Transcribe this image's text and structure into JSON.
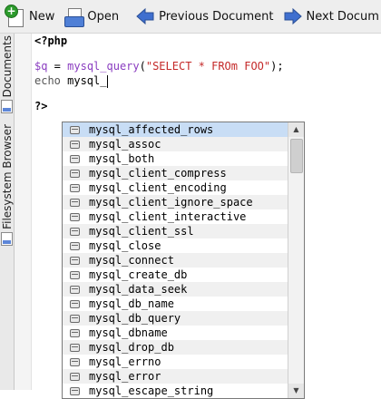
{
  "toolbar": {
    "new_label": "New",
    "open_label": "Open",
    "prev_label": "Previous Document",
    "next_label": "Next Docum"
  },
  "side_panel": {
    "tab1_label": "Documents",
    "tab2_label": "Filesystem Browser"
  },
  "editor": {
    "line1": "<?php",
    "line2_var": "$q",
    "line2_eq": " = ",
    "line2_fn": "mysql_query",
    "line2_open": "(",
    "line2_str": "\"SELECT * FROm FOO\"",
    "line2_close": ");",
    "line3_echo": "echo",
    "line3_text": " mysql_",
    "line4": "?>"
  },
  "autocomplete": {
    "items": [
      "mysql_affected_rows",
      "mysql_assoc",
      "mysql_both",
      "mysql_client_compress",
      "mysql_client_encoding",
      "mysql_client_ignore_space",
      "mysql_client_interactive",
      "mysql_client_ssl",
      "mysql_close",
      "mysql_connect",
      "mysql_create_db",
      "mysql_data_seek",
      "mysql_db_name",
      "mysql_db_query",
      "mysql_dbname",
      "mysql_drop_db",
      "mysql_errno",
      "mysql_error",
      "mysql_escape_string"
    ],
    "selected_index": 0
  }
}
